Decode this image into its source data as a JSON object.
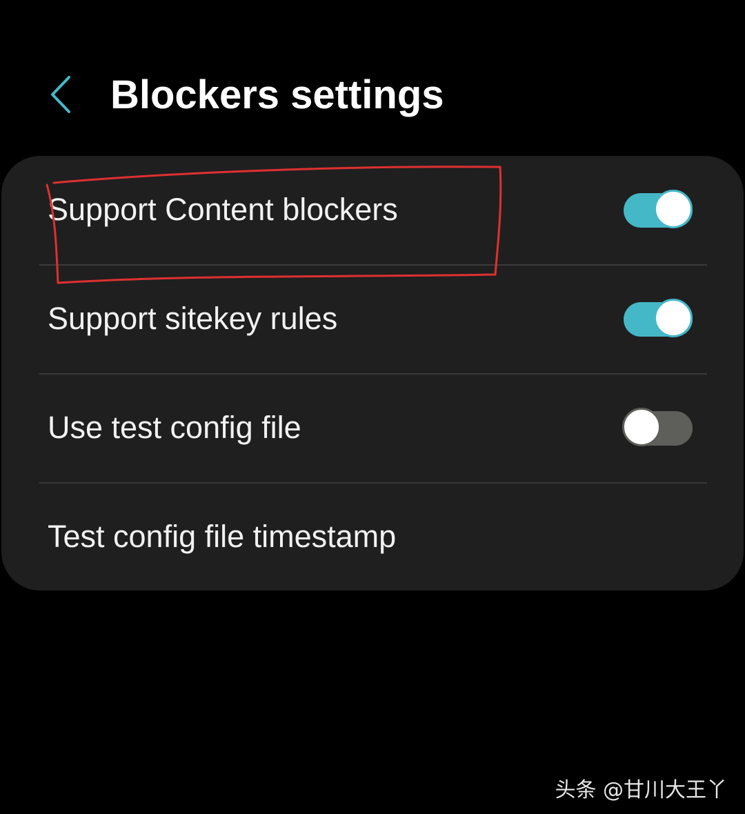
{
  "header": {
    "back_icon": "chevron-left-icon",
    "title": "Blockers settings"
  },
  "colors": {
    "background": "#000000",
    "card": "#1f1f1f",
    "accent_on": "#45b8c8",
    "track_off": "#5e5e5a",
    "annotation": "#e03030"
  },
  "settings": {
    "items": [
      {
        "label": "Support Content blockers",
        "toggle": true
      },
      {
        "label": "Support sitekey rules",
        "toggle": true
      },
      {
        "label": "Use test config file",
        "toggle": false
      },
      {
        "label": "Test config file timestamp"
      }
    ]
  },
  "watermark": "头条 @甘川大王丫"
}
